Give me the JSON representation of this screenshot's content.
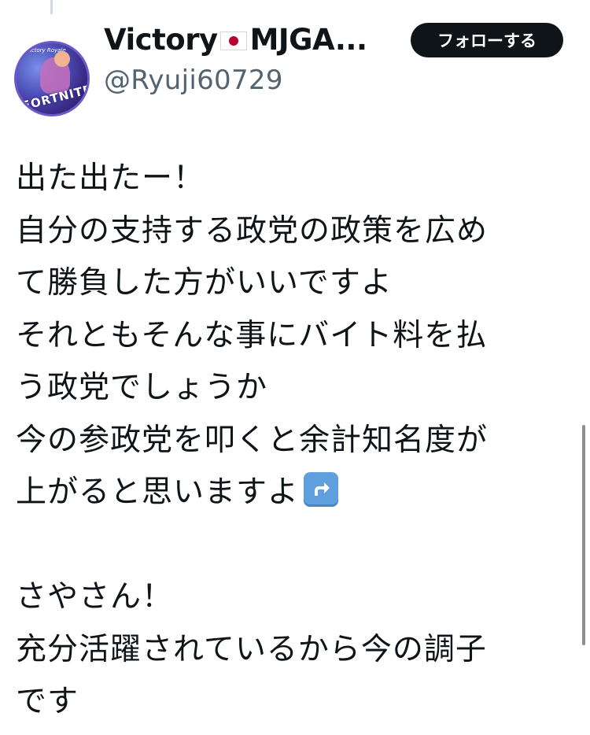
{
  "tweet": {
    "author": {
      "display_name": "Victory",
      "display_name_suffix": "MJGA...",
      "handle": "@Ryuji60729",
      "avatar_logo": "FORTNITE",
      "avatar_watermark": "Victory Royale"
    },
    "follow_label": "フォローする",
    "body_lines": [
      "出た出たー！",
      "自分の支持する政党の政策を広め",
      "て勝負した方がいいですよ",
      "それともそんな事にバイト料を払",
      "う政党でしょうか",
      "今の参政党を叩くと余計知名度が",
      "上がると思いますよ",
      "",
      "さやさん！",
      "充分活躍されているから今の調子",
      "です"
    ],
    "icons": {
      "flag": "japan-flag-icon",
      "emoji": "up-right-arrow-emoji-icon"
    }
  }
}
